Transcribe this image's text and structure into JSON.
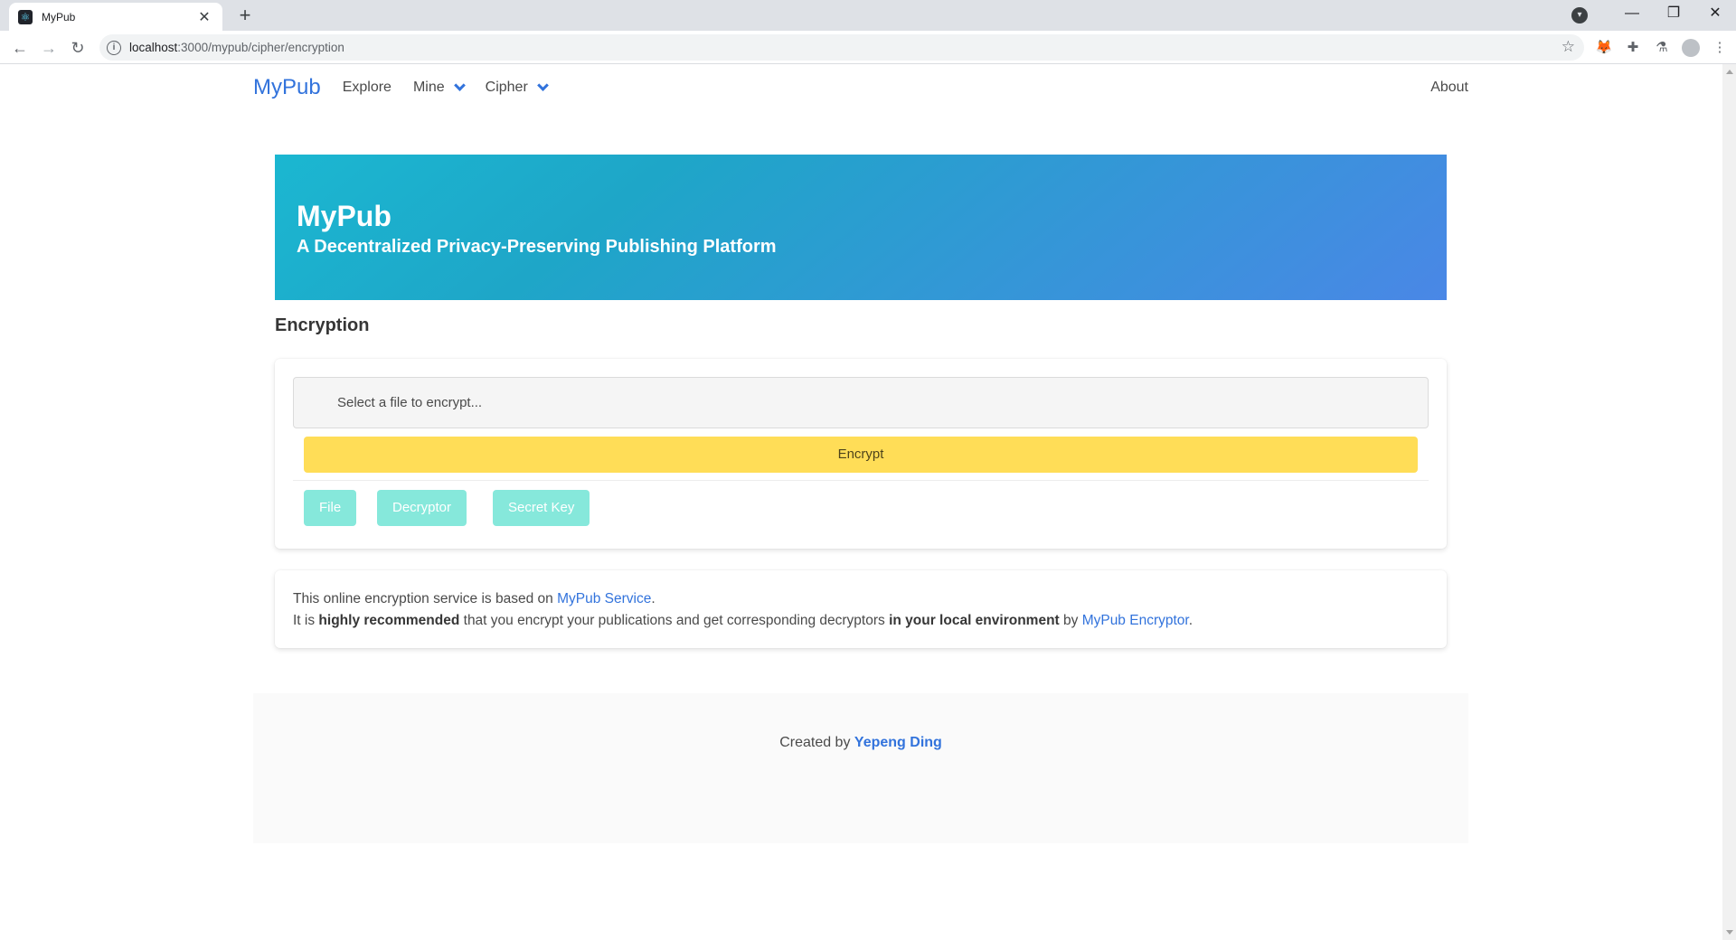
{
  "browser": {
    "tab_title": "MyPub",
    "tab_close": "✕",
    "new_tab": "+",
    "url_host": "localhost",
    "url_path": ":3000/mypub/cipher/encryption"
  },
  "navbar": {
    "brand": "MyPub",
    "items": [
      {
        "label": "Explore"
      },
      {
        "label": "Mine"
      },
      {
        "label": "Cipher"
      }
    ],
    "about": "About"
  },
  "hero": {
    "title": "MyPub",
    "subtitle": "A Decentralized Privacy-Preserving Publishing Platform"
  },
  "section": {
    "title": "Encryption"
  },
  "encrypt_card": {
    "file_placeholder": "Select a file to encrypt...",
    "encrypt_label": "Encrypt",
    "downloads": [
      {
        "label": "File"
      },
      {
        "label": "Decryptor"
      },
      {
        "label": "Secret Key"
      }
    ]
  },
  "note": {
    "line1_text": "This online encryption service is based on ",
    "line1_link": "MyPub Service",
    "line1_end": ".",
    "line2_a": "It is ",
    "line2_bold1": "highly recommended",
    "line2_b": " that you encrypt your publications and get corresponding decryptors ",
    "line2_bold2": "in your local environment",
    "line2_c": " by ",
    "line2_link": "MyPub Encryptor",
    "line2_end": "."
  },
  "footer": {
    "created_by": "Created by ",
    "author": "Yepeng Ding"
  },
  "colors": {
    "link": "#3273dc",
    "encrypt_button": "#ffdd57",
    "download_button": "#86e8db",
    "hero_gradient_start": "#1bb7d1",
    "hero_gradient_end": "#4a87e6"
  }
}
